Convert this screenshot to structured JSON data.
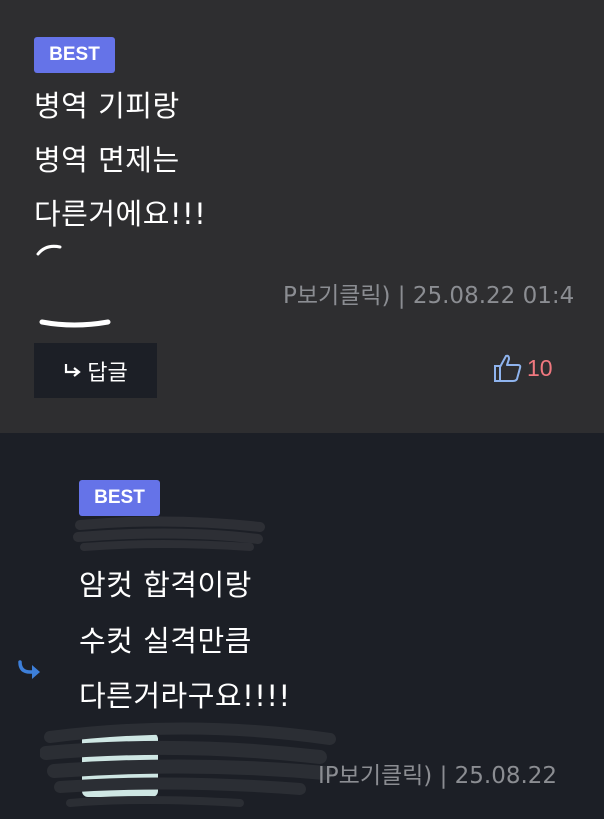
{
  "comments": [
    {
      "badge": "BEST",
      "lines": [
        "병역 기피랑",
        "병역 면제는",
        "다른거에요!!!"
      ],
      "meta": "P보기클릭) | 25.08.22 01:4",
      "reply_label": "답글",
      "likes": "10"
    },
    {
      "badge": "BEST",
      "lines": [
        "암컷 합격이랑",
        "수컷 실격만큼",
        "다른거라구요!!!!"
      ],
      "meta": "IP보기클릭) | 25.08.22"
    }
  ],
  "colors": {
    "badge": "#6573e8",
    "like_count": "#f0787f",
    "reply_arrow": "#3d7fd9"
  }
}
